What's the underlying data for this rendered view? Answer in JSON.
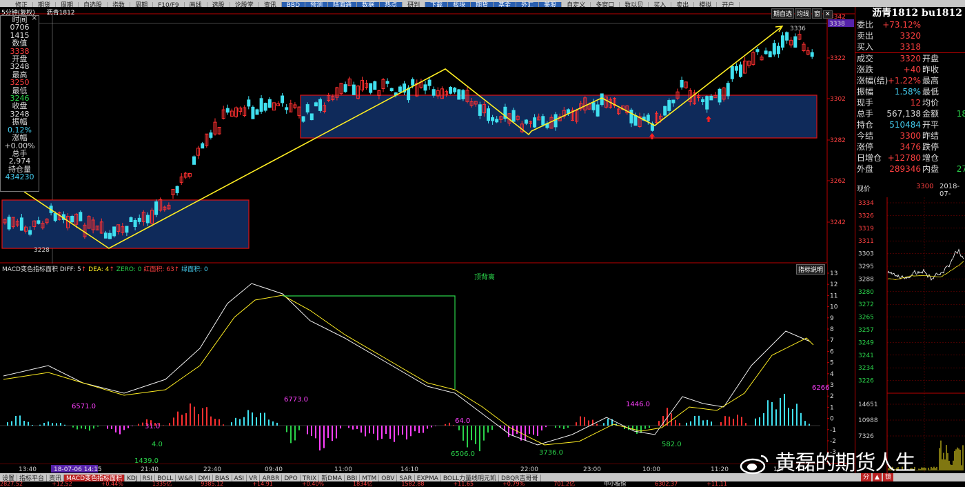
{
  "top_menu": [
    "",
    "修正",
    "期货",
    "周期",
    "自选股",
    "指数",
    "周期",
    "F10/F9",
    "画线",
    "选股",
    "论股堂",
    "资讯",
    "BBD",
    "预测",
    "陆海通",
    "数据",
    "热点",
    "研判",
    "下载",
    "板块",
    "期货",
    "基金",
    "外汇",
    "美股",
    "自定义",
    "多窗口",
    "数以贝",
    "买入",
    "卖出",
    "模拟",
    "开户"
  ],
  "chart_header": {
    "period": "5分钟(复权)",
    "name": "沥青1812"
  },
  "chart_toolbar": [
    "期自选",
    "均线",
    "窗",
    "✕"
  ],
  "data_box": {
    "time_label": "时间",
    "time1": "0706",
    "time2": "1415",
    "value_label": "数值",
    "value": "3338",
    "open_label": "开盘",
    "open": "3248",
    "high_label": "最高",
    "high": "3250",
    "low_label": "最低",
    "low": "3246",
    "close_label": "收盘",
    "close": "3248",
    "amp_label": "振幅",
    "amp": "0.12%",
    "chg_label": "涨幅",
    "chg": "+0.00%",
    "vol_label": "总手",
    "vol": "2,974",
    "oi_label": "持仓量",
    "oi": "434230"
  },
  "price_axis": [
    "3342",
    "3338",
    "3322",
    "3302",
    "3282",
    "3262",
    "3242"
  ],
  "high_mark": "3338",
  "peak_label": "3336",
  "low_label_chart": "3228",
  "macd_header": {
    "name": "MACD变色指标面积",
    "diff": "DIFF: 5",
    "dea": "DEA: 4",
    "zero": "ZERO: 0",
    "red": "红面积: 63",
    "green": "绿面积: 0",
    "explain": "指标说明"
  },
  "macd_axis": [
    "13",
    "12",
    "11",
    "10",
    "9",
    "8",
    "7",
    "6",
    "5",
    "4",
    "3",
    "2",
    "1",
    "0",
    "-1",
    "-2",
    "-3"
  ],
  "divergence_label": "顶背离",
  "macd_labels": [
    {
      "t": "6571.0",
      "c": "#ff40ff"
    },
    {
      "t": "31.0",
      "c": "#ff40ff"
    },
    {
      "t": "4.0",
      "c": "#2ad24a"
    },
    {
      "t": "1439.0",
      "c": "#2ad24a"
    },
    {
      "t": "6773.0",
      "c": "#ff40ff"
    },
    {
      "t": "64.0",
      "c": "#ff40ff"
    },
    {
      "t": "6506.0",
      "c": "#2ad24a"
    },
    {
      "t": "3736.0",
      "c": "#2ad24a"
    },
    {
      "t": "1446.0",
      "c": "#ff40ff"
    },
    {
      "t": "582.0",
      "c": "#2ad24a"
    },
    {
      "t": "6266",
      "c": "#ff40ff"
    }
  ],
  "time_axis": [
    "13:40",
    "18-07-06 14:15",
    "21:40",
    "22:40",
    "09:40",
    "11:00",
    "14:10",
    "22:00",
    "23:00",
    "10:00",
    "11:20",
    "14:"
  ],
  "right_panel": {
    "title": "沥青1812 bu1812",
    "rows": [
      {
        "l": "委比",
        "v": "+73.12%",
        "vc": "#ff4040",
        "l2": "",
        "v2": ""
      },
      {
        "l": "卖出",
        "v": "3320",
        "vc": "#ff4040",
        "l2": "",
        "v2": ""
      },
      {
        "l": "买入",
        "v": "3318",
        "vc": "#ff4040",
        "l2": "",
        "v2": ""
      },
      {
        "l": "成交",
        "v": "3320",
        "vc": "#ff4040",
        "l2": "开盘",
        "v2": ""
      },
      {
        "l": "涨跌",
        "v": "+40",
        "vc": "#ff4040",
        "l2": "昨收",
        "v2": ""
      },
      {
        "l": "涨幅(结)",
        "v": "+1.22%",
        "vc": "#ff4040",
        "l2": "最高",
        "v2": ""
      },
      {
        "l": "振幅",
        "v": "1.58%",
        "vc": "#44ccee",
        "l2": "最低",
        "v2": ""
      },
      {
        "l": "现手",
        "v": "12",
        "vc": "#ff4040",
        "l2": "均价",
        "v2": ""
      },
      {
        "l": "总手",
        "v": "567,138",
        "vc": "#ddd",
        "l2": "金额",
        "v2": "18"
      },
      {
        "l": "持仓",
        "v": "510484",
        "vc": "#44ccee",
        "l2": "开平",
        "v2": ""
      },
      {
        "l": "今结",
        "v": "3300",
        "vc": "#ff4040",
        "l2": "昨结",
        "v2": ""
      },
      {
        "l": "涨停",
        "v": "3476",
        "vc": "#ff4040",
        "l2": "跌停",
        "v2": ""
      },
      {
        "l": "日增仓",
        "v": "+12780",
        "vc": "#ff4040",
        "l2": "增仓",
        "v2": ""
      },
      {
        "l": "外盘",
        "v": "289346",
        "vc": "#ff4040",
        "l2": "内盘",
        "v2": "27"
      }
    ],
    "mini_head": {
      "label": "现价",
      "price": "3300",
      "date": "2018-07-"
    },
    "mini_axis": [
      "3334",
      "3326",
      "3319",
      "3311",
      "3303",
      "3295",
      "3288",
      "3280",
      "3272",
      "3265",
      "3257",
      "3249",
      "3241",
      "3234",
      "3226",
      "14651",
      "10988",
      "7326"
    ]
  },
  "tabs": [
    "设置",
    "指标平台",
    "资讯",
    "MACD变色指标面积",
    "KDJ",
    "RSI",
    "BOLL",
    "W&R",
    "DMI",
    "BIAS",
    "ASI",
    "VR",
    "ARBR",
    "DPO",
    "TRIX",
    "新DMA",
    "BBI",
    "MTM",
    "OBV",
    "SAR",
    "EXPMA",
    "BOLL力量线明元凯",
    "DBQR吉哥哥"
  ],
  "tabs_right": [
    "分",
    "▲",
    "锁"
  ],
  "status": [
    "2827.52",
    "+12.52",
    "+0.44%",
    "1335亿",
    "9385.12",
    "+14.91",
    "+0.40%",
    "1834亿",
    "1582.88",
    "+11.65",
    "+0.79%",
    "701.2亿",
    "中小板指",
    "6302.37",
    "+11.11"
  ],
  "watermark": "黄磊的期货人生"
}
